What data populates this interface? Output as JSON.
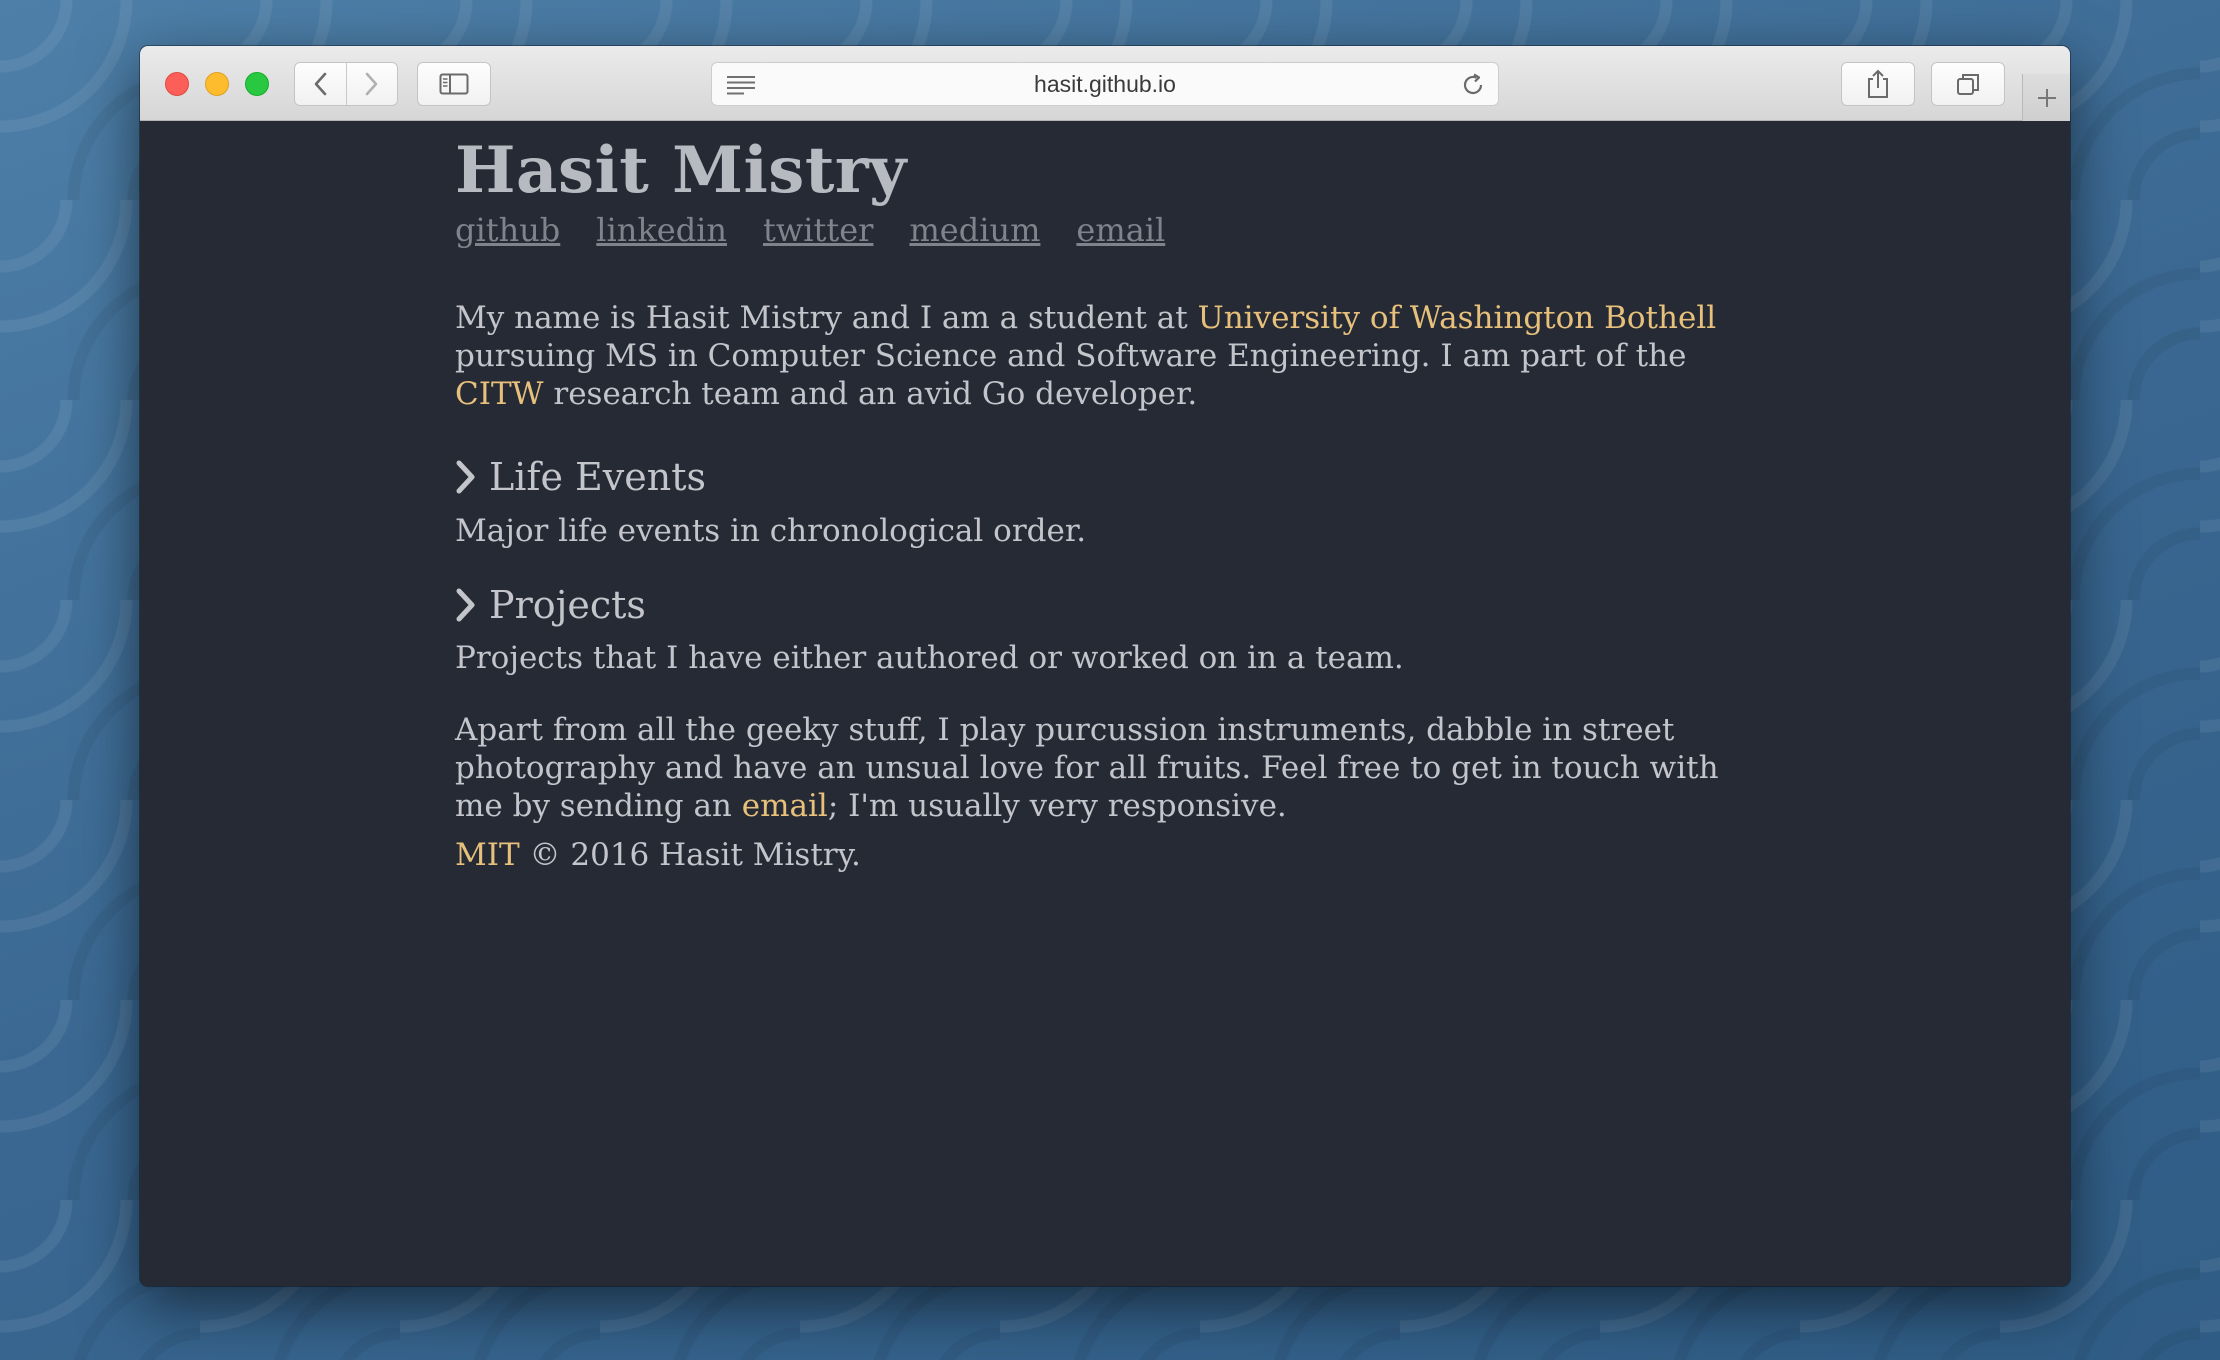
{
  "browser": {
    "url": "hasit.github.io"
  },
  "colors": {
    "accent": "#e7c07b",
    "page_background": "#262a35",
    "text": "#c3c5cb"
  },
  "header": {
    "name": "Hasit Mistry",
    "links": [
      "github",
      "linkedin",
      "twitter",
      "medium",
      "email"
    ]
  },
  "intro": {
    "part1": "My name is Hasit Mistry and I am a student at ",
    "university": "University of Washington Bothell",
    "part2": " pursuing MS in Computer Science and Software Engineering. I am part of the ",
    "team": "CITW",
    "part3": " research team and an avid Go developer."
  },
  "sections": [
    {
      "title": "Life Events",
      "description": "Major life events in chronological order."
    },
    {
      "title": "Projects",
      "description": "Projects that I have either authored or worked on in a team."
    }
  ],
  "outro": {
    "part1": "Apart from all the geeky stuff, I play purcussion instruments, dabble in street photography and have an unsual love for all fruits. Feel free to get in touch with me by sending an ",
    "email_link": "email",
    "part2": "; I'm usually very responsive."
  },
  "footer": {
    "license": "MIT",
    "copyright": " © 2016 Hasit Mistry."
  }
}
